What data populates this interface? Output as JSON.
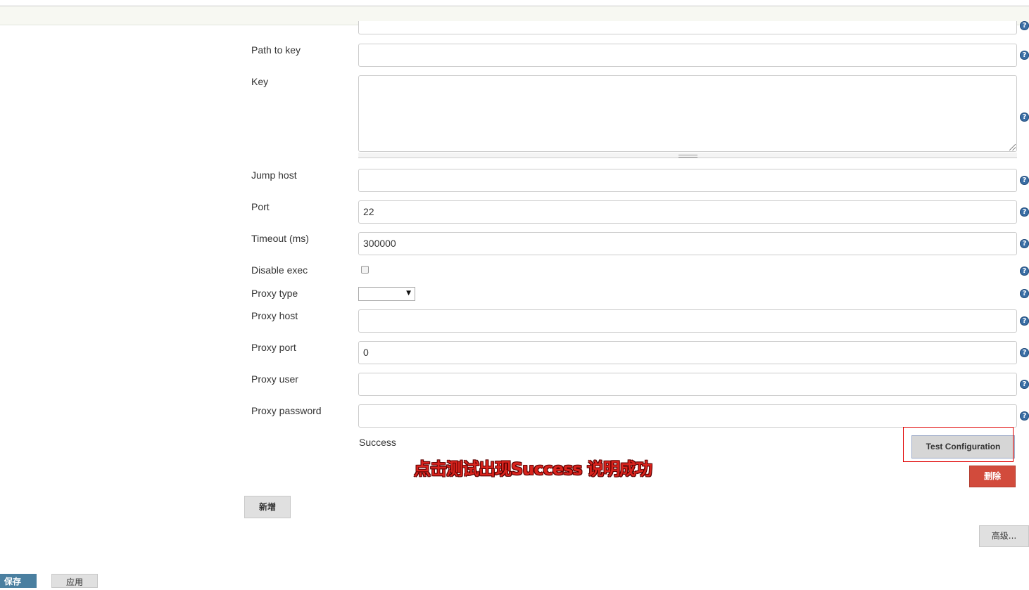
{
  "form": {
    "fields": {
      "path_to_key": {
        "label": "Path to key",
        "value": ""
      },
      "key": {
        "label": "Key",
        "value": ""
      },
      "jump_host": {
        "label": "Jump host",
        "value": ""
      },
      "port": {
        "label": "Port",
        "value": "22"
      },
      "timeout": {
        "label": "Timeout (ms)",
        "value": "300000"
      },
      "disable_exec": {
        "label": "Disable exec",
        "checked": false
      },
      "proxy_type": {
        "label": "Proxy type",
        "value": ""
      },
      "proxy_host": {
        "label": "Proxy host",
        "value": ""
      },
      "proxy_port": {
        "label": "Proxy port",
        "value": "0"
      },
      "proxy_user": {
        "label": "Proxy user",
        "value": ""
      },
      "proxy_password": {
        "label": "Proxy password",
        "value": ""
      }
    },
    "help_icon_glyph": "?",
    "select_arrow_glyph": "▼",
    "test_result": "Success",
    "annotation": "点击测试出现Success 说明成功"
  },
  "buttons": {
    "test_configuration": "Test Configuration",
    "delete": "删除",
    "add": "新增",
    "advanced": "高级...",
    "save": "保存",
    "apply": "应用"
  },
  "colors": {
    "help_icon": "#3a6ea5",
    "delete_button": "#d24b3c",
    "annotation_text": "#d9231d",
    "highlight_border": "#e00000",
    "save_button": "#4a7fa0"
  }
}
